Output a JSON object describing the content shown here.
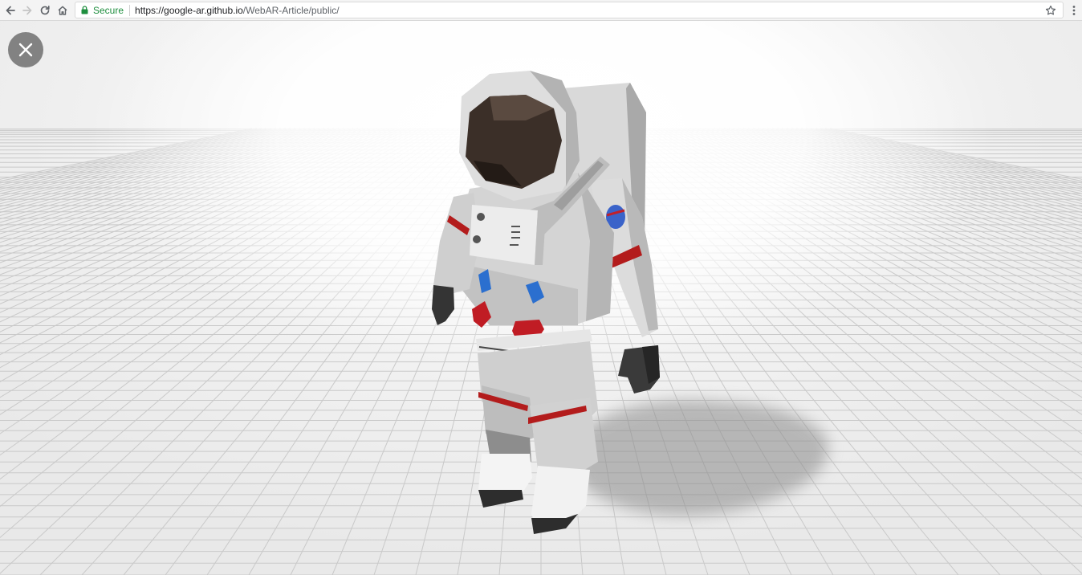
{
  "browser": {
    "back_icon": "arrow-left-icon",
    "forward_icon": "arrow-right-icon",
    "reload_icon": "reload-icon",
    "home_icon": "home-icon",
    "secure_label": "Secure",
    "url_host": "https://google-ar.github.io",
    "url_path": "/WebAR-Article/public/",
    "bookmark_icon": "star-icon",
    "menu_icon": "kebab-menu-icon",
    "secure_color": "#1e8e3e"
  },
  "viewer": {
    "close_icon": "close-icon",
    "model": "astronaut",
    "ground": "grid-floor"
  }
}
